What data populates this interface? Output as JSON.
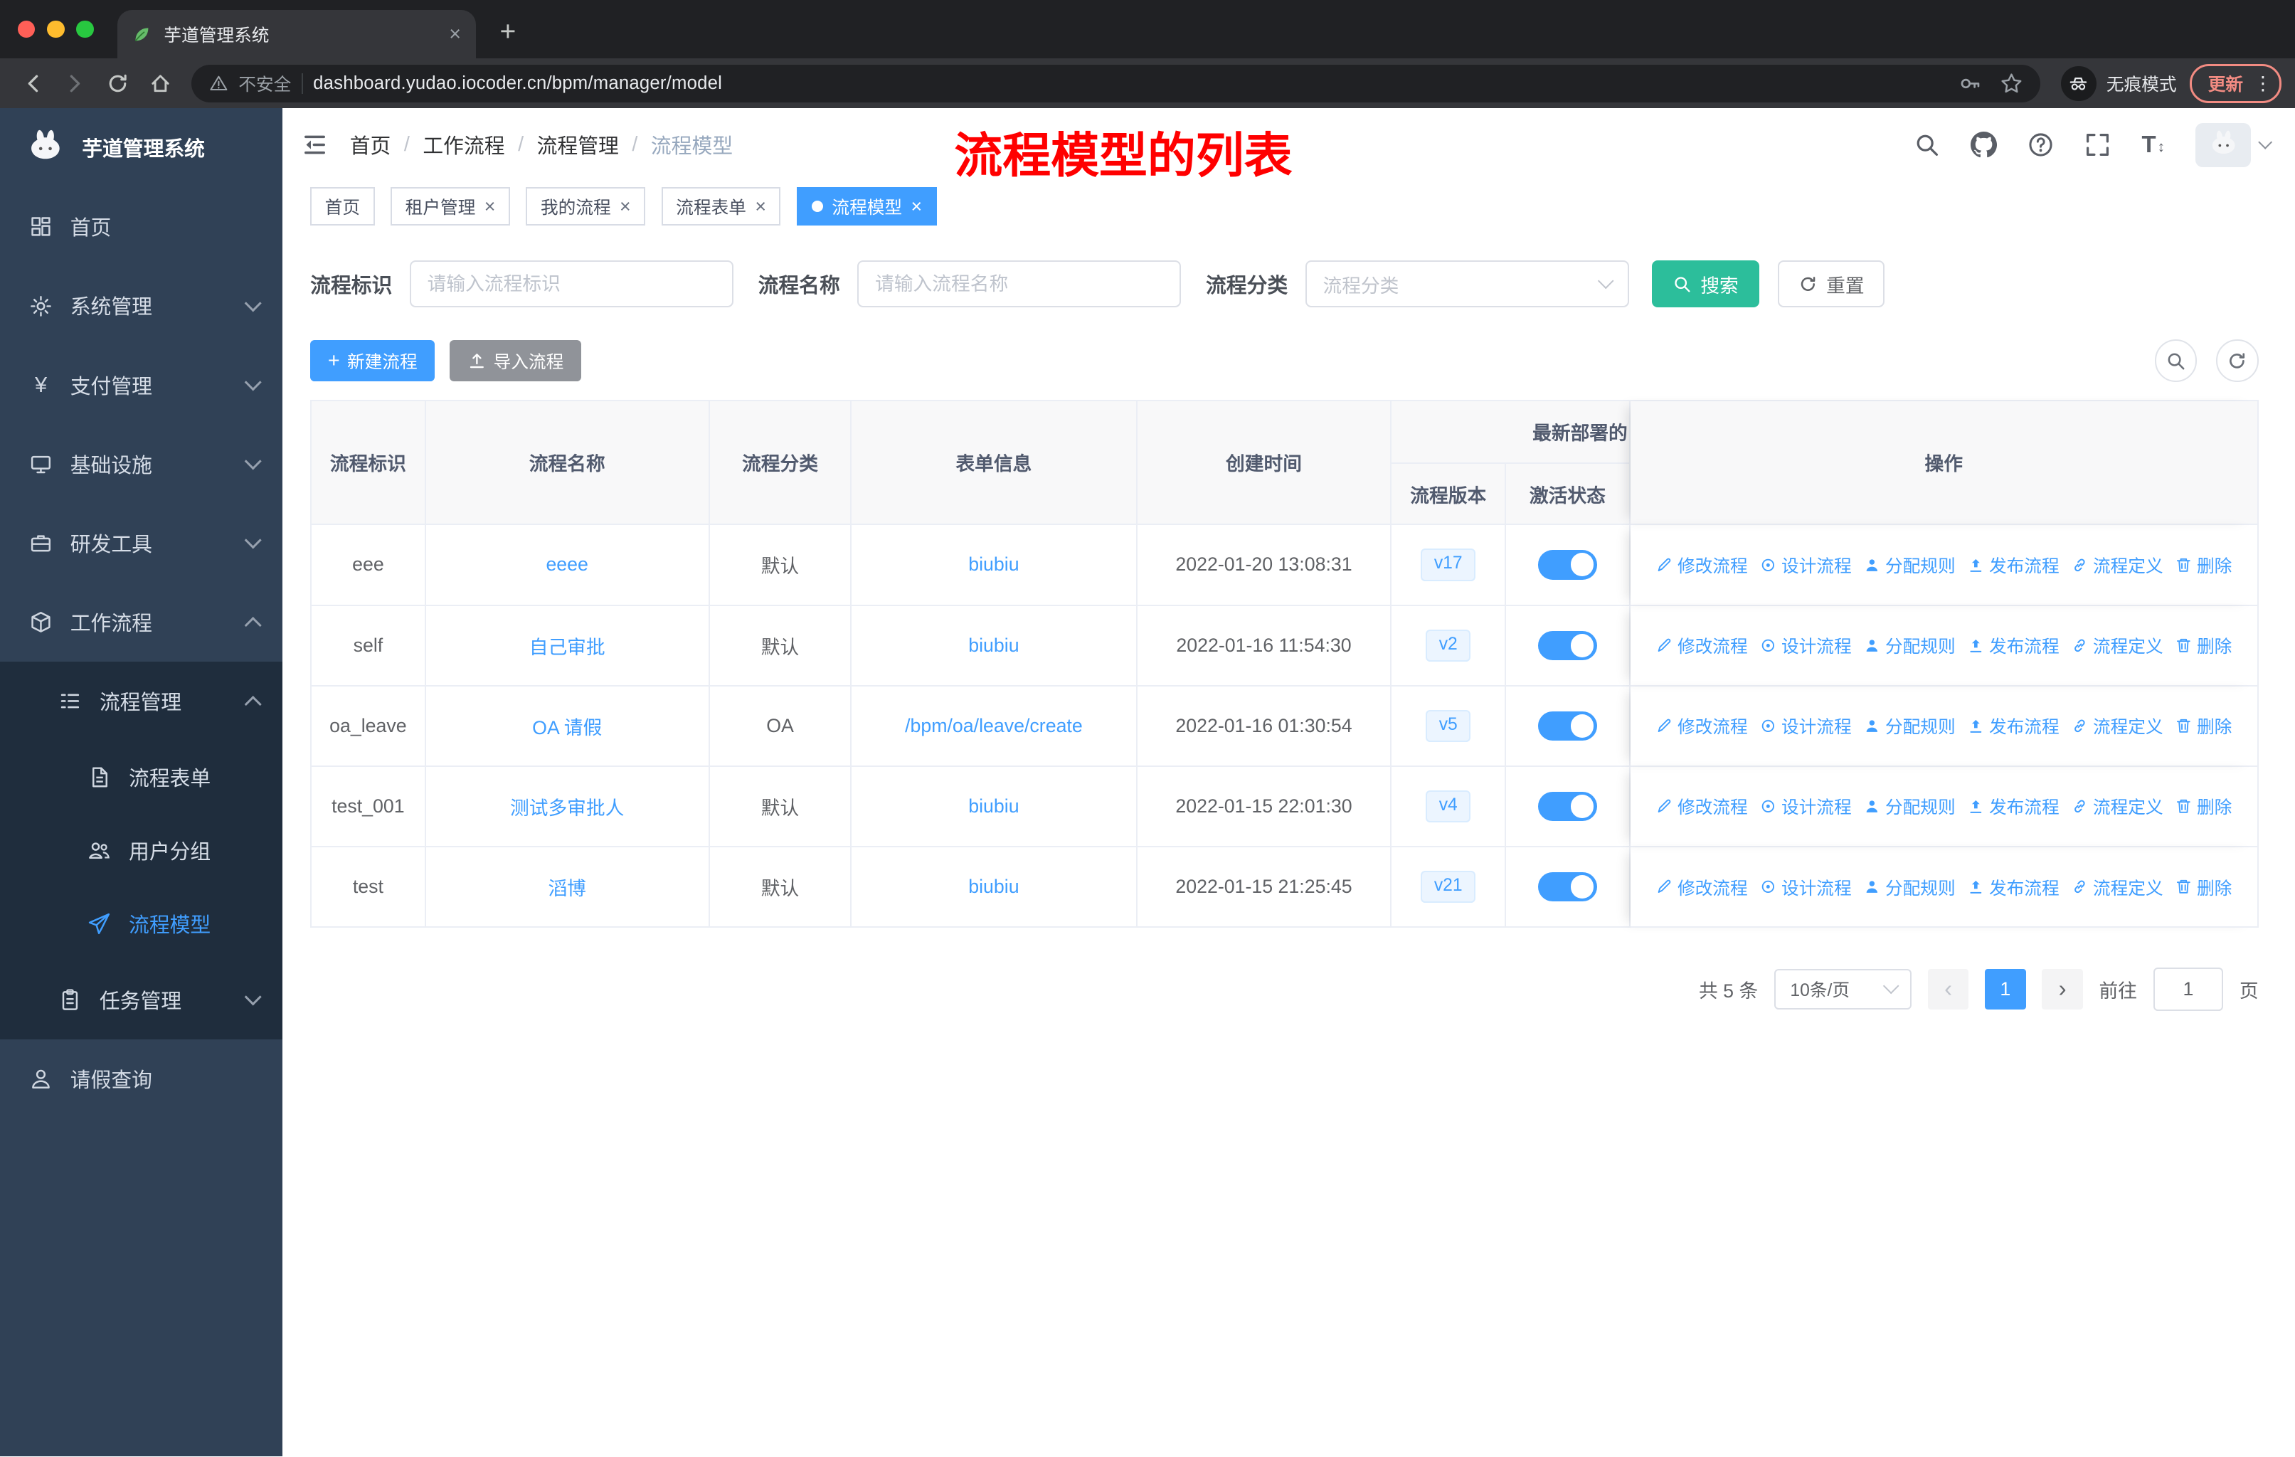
{
  "browser": {
    "tab_title": "芋道管理系统",
    "security_label": "不安全",
    "url": "dashboard.yudao.iocoder.cn/bpm/manager/model",
    "incognito_label": "无痕模式",
    "update_label": "更新"
  },
  "glyphs": {
    "close": "×",
    "plus": "+",
    "kebab": "⋮",
    "prev": "‹",
    "next": "›",
    "slash": "/",
    "font_t": "T",
    "font_arrows": "↕",
    "yen": "¥"
  },
  "sidebar": {
    "logo_title": "芋道管理系统",
    "home": "首页",
    "system": "系统管理",
    "payment": "支付管理",
    "infra": "基础设施",
    "devtools": "研发工具",
    "workflow": "工作流程",
    "process_mgmt": "流程管理",
    "process_form": "流程表单",
    "user_group": "用户分组",
    "process_model": "流程模型",
    "task_mgmt": "任务管理",
    "leave_query": "请假查询"
  },
  "header": {
    "breadcrumb": [
      "首页",
      "工作流程",
      "流程管理",
      "流程模型"
    ],
    "annotation": "流程模型的列表"
  },
  "tags": [
    {
      "label": "首页",
      "closable": false,
      "active": false
    },
    {
      "label": "租户管理",
      "closable": true,
      "active": false
    },
    {
      "label": "我的流程",
      "closable": true,
      "active": false
    },
    {
      "label": "流程表单",
      "closable": true,
      "active": false
    },
    {
      "label": "流程模型",
      "closable": true,
      "active": true
    }
  ],
  "filters": {
    "id_label": "流程标识",
    "id_placeholder": "请输入流程标识",
    "name_label": "流程名称",
    "name_placeholder": "请输入流程名称",
    "category_label": "流程分类",
    "category_placeholder": "流程分类",
    "search_label": "搜索",
    "reset_label": "重置"
  },
  "toolbar": {
    "create_label": "新建流程",
    "import_label": "导入流程"
  },
  "table": {
    "headers": {
      "id": "流程标识",
      "name": "流程名称",
      "category": "流程分类",
      "form": "表单信息",
      "created": "创建时间",
      "deploy_group": "最新部署的",
      "version": "流程版本",
      "status": "激活状态",
      "op": "操作"
    },
    "actions": [
      "修改流程",
      "设计流程",
      "分配规则",
      "发布流程",
      "流程定义",
      "删除"
    ],
    "rows": [
      {
        "id": "eee",
        "name": "eeee",
        "category": "默认",
        "form": "biubiu",
        "created": "2022-01-20 13:08:31",
        "version": "v17",
        "status_on": true
      },
      {
        "id": "self",
        "name": "自己审批",
        "category": "默认",
        "form": "biubiu",
        "created": "2022-01-16 11:54:30",
        "version": "v2",
        "status_on": true
      },
      {
        "id": "oa_leave",
        "name": "OA 请假",
        "category": "OA",
        "form": "/bpm/oa/leave/create",
        "created": "2022-01-16 01:30:54",
        "version": "v5",
        "status_on": true
      },
      {
        "id": "test_001",
        "name": "测试多审批人",
        "category": "默认",
        "form": "biubiu",
        "created": "2022-01-15 22:01:30",
        "version": "v4",
        "status_on": true
      },
      {
        "id": "test",
        "name": "滔博",
        "category": "默认",
        "form": "biubiu",
        "created": "2022-01-15 21:25:45",
        "version": "v21",
        "status_on": true
      }
    ]
  },
  "pagination": {
    "total": "共 5 条",
    "page_size": "10条/页",
    "current": "1",
    "goto_label": "前往",
    "goto_value": "1",
    "page_unit": "页"
  },
  "colors": {
    "primary": "#409eff",
    "search_button": "#2cbe9b",
    "sidebar_bg": "#304156",
    "submenu_bg": "#1f2d3d",
    "annotation_red": "#ff0000",
    "switch_on": "#409eff",
    "version_tag_bg": "#ecf5ff"
  }
}
